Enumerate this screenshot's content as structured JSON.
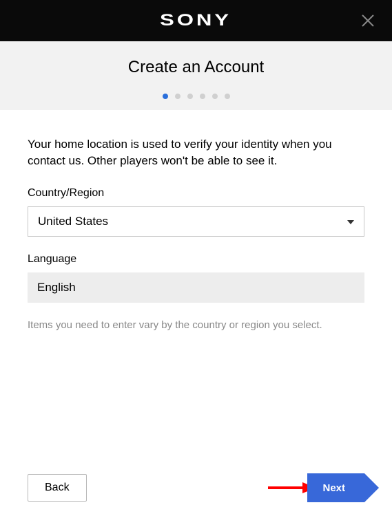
{
  "header": {
    "logo_text": "SONY"
  },
  "subheader": {
    "title": "Create an Account",
    "total_steps": 6,
    "current_step": 1
  },
  "content": {
    "intro": "Your home location is used to verify your identity when you contact us. Other players won't be able to see it.",
    "country_label": "Country/Region",
    "country_value": "United States",
    "language_label": "Language",
    "language_value": "English",
    "hint": "Items you need to enter vary by the country or region you select."
  },
  "footer": {
    "back_label": "Back",
    "next_label": "Next"
  },
  "annotation": {
    "arrow_color": "#ff0000"
  }
}
